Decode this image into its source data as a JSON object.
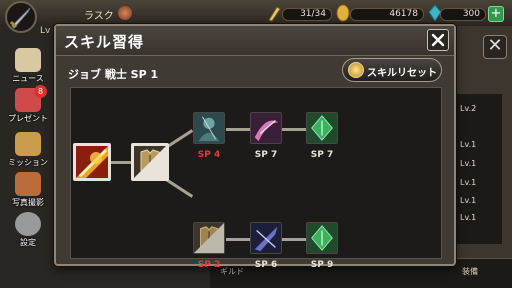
{
  "background": {
    "player_name": "ラスク",
    "level_prefix": "Lv",
    "stamina": "31/34",
    "gold": "46178",
    "gems": "300",
    "plus": "+",
    "side_menu": [
      {
        "label": "ニュース",
        "badge": ""
      },
      {
        "label": "プレゼント",
        "badge": "8"
      },
      {
        "label": "ミッション",
        "badge": ""
      },
      {
        "label": "写真撮影",
        "badge": ""
      },
      {
        "label": "設定",
        "badge": ""
      }
    ],
    "close": "✕",
    "list_levels": [
      "Lv.2",
      "Lv.1",
      "Lv.1",
      "Lv.1",
      "Lv.1",
      "Lv.1"
    ],
    "bottom_left": "ギルド",
    "bottom_right": "装備"
  },
  "modal": {
    "title": "スキル習得",
    "job_label": "ジョブ 戦士 SP 1",
    "reset_label": "スキルリセット"
  },
  "skill_tree": {
    "upper_branch": [
      "SP 4",
      "SP 7",
      "SP 7"
    ],
    "lower_branch": [
      "SP 2",
      "SP 6",
      "SP 9"
    ],
    "colors": {
      "unaffordable": "#e3393a",
      "affordable": "#e6e2d8"
    }
  }
}
